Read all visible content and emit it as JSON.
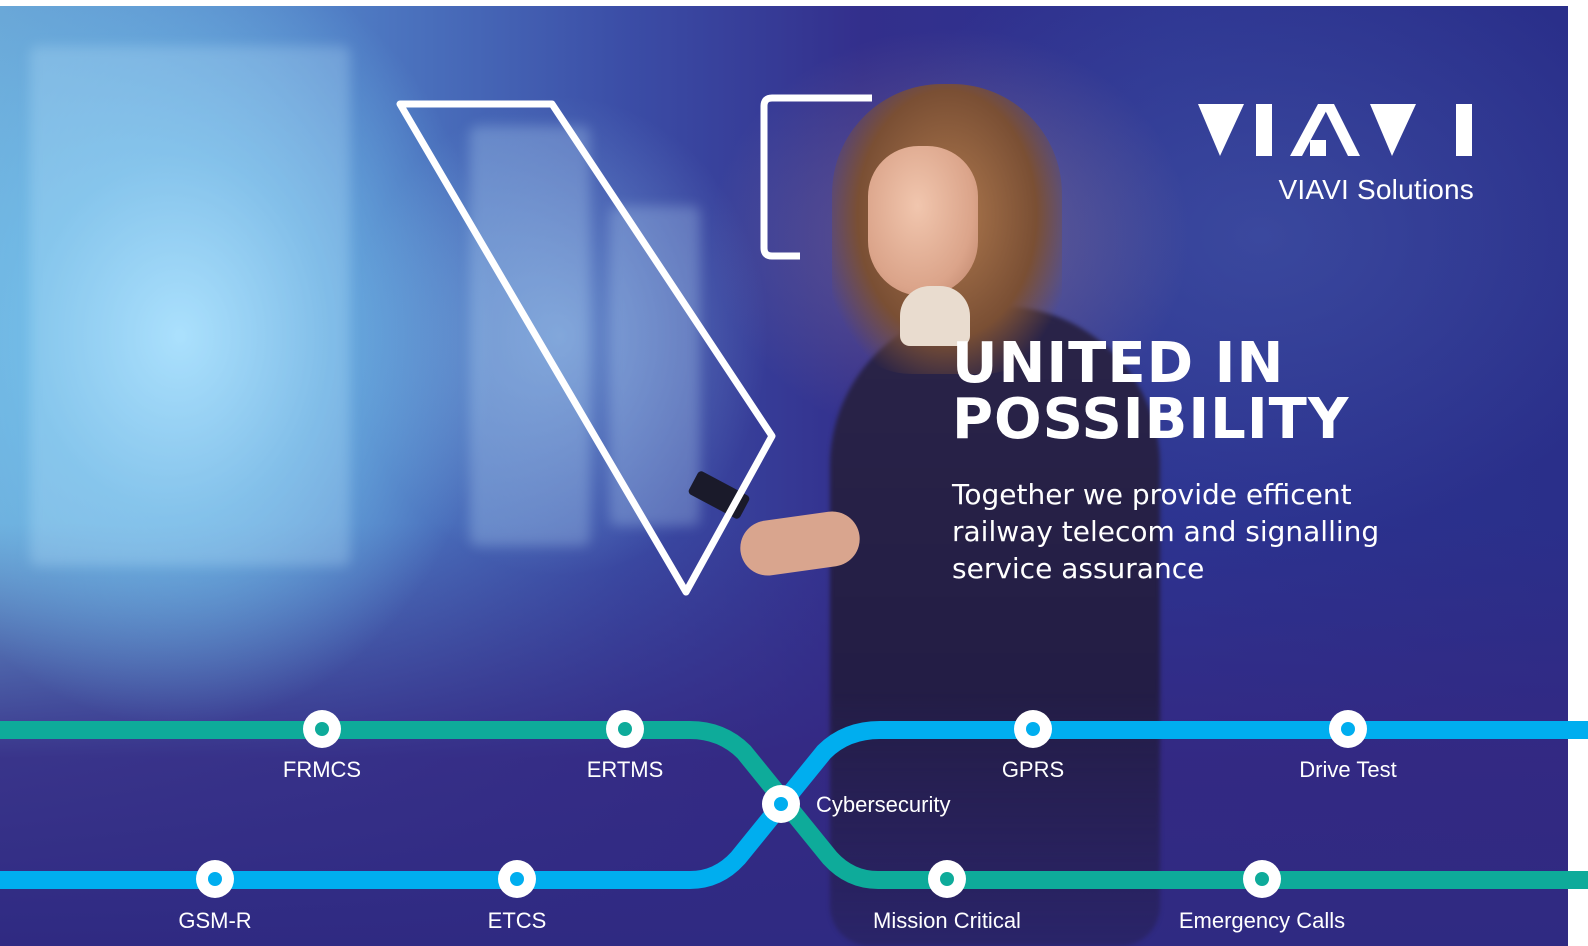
{
  "brand": {
    "logo_wordmark": "VIAVI",
    "name": "VIAVI Solutions"
  },
  "headline": {
    "line1": "UNITED IN",
    "line2": "POSSIBILITY"
  },
  "subheadline": {
    "line1": "Together we provide efficent",
    "line2": "railway telecom and signalling",
    "line3": "service assurance"
  },
  "colors": {
    "teal_line": "#0eab9a",
    "blue_line": "#00aeef",
    "station_fill": "#ffffff",
    "background_deep": "#2f2a82"
  },
  "network": {
    "teal_stations": [
      "FRMCS",
      "ERTMS",
      "Mission Critical",
      "Emergency Calls"
    ],
    "blue_stations": [
      "GSM-R",
      "ETCS",
      "GPRS",
      "Drive Test"
    ],
    "interchange": "Cybersecurity"
  }
}
